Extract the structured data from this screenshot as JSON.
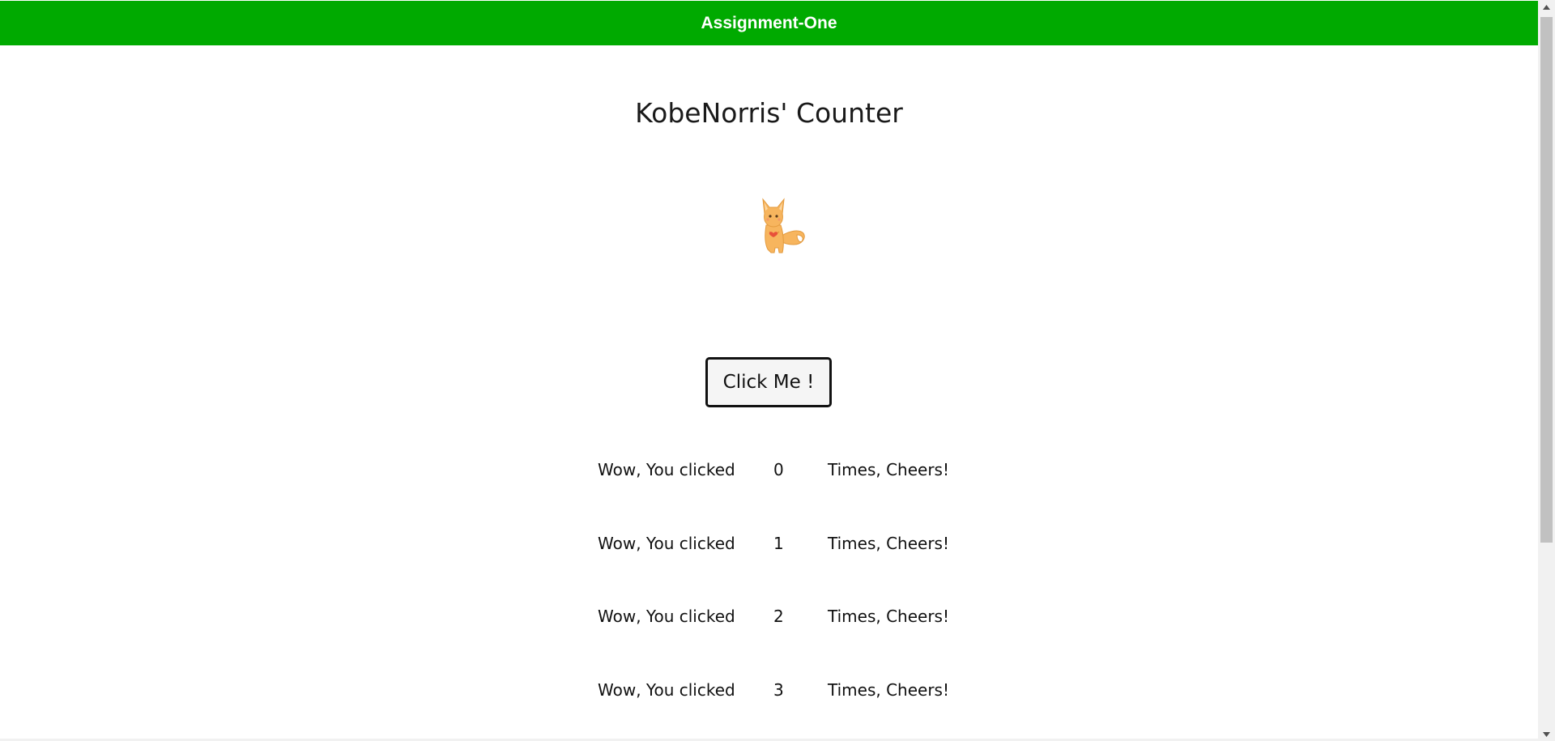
{
  "header": {
    "title": "Assignment-One"
  },
  "main": {
    "title": "KobeNorris' Counter",
    "mascot_icon": "fox-mascot-icon",
    "button_label": "Click Me !",
    "rows": [
      {
        "prefix": "Wow, You clicked",
        "count": "0",
        "suffix": "Times, Cheers!"
      },
      {
        "prefix": "Wow, You clicked",
        "count": "1",
        "suffix": "Times, Cheers!"
      },
      {
        "prefix": "Wow, You clicked",
        "count": "2",
        "suffix": "Times, Cheers!"
      },
      {
        "prefix": "Wow, You clicked",
        "count": "3",
        "suffix": "Times, Cheers!"
      }
    ]
  },
  "colors": {
    "header_bg": "#00aa00",
    "header_text": "#ffffff",
    "button_bg": "#f5f5f5",
    "button_border": "#111111",
    "fox_body": "#f7b55e",
    "fox_heart": "#e8503a"
  }
}
